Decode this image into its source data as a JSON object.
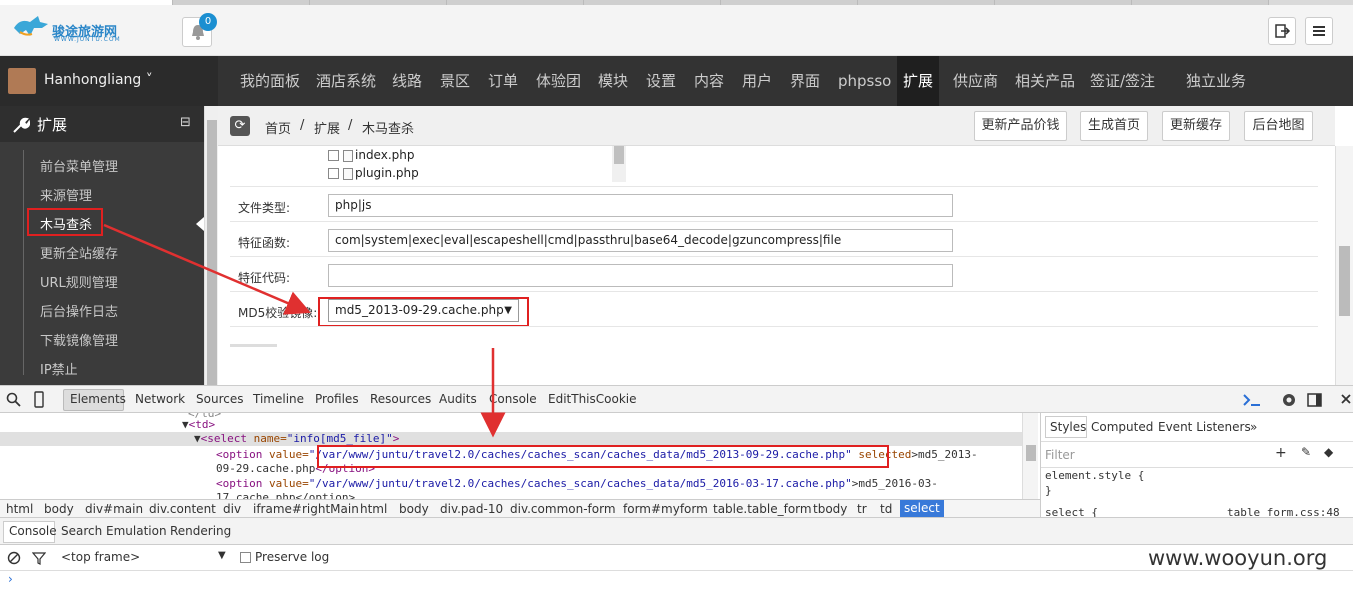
{
  "header": {
    "logo_text": "骏途旅游网",
    "logo_sub": "WWW.JUNTU.COM",
    "notification_count": "0"
  },
  "user": {
    "name": "Hanhongliang"
  },
  "nav": {
    "items": [
      "我的面板",
      "酒店系统",
      "线路",
      "景区",
      "订单",
      "体验团",
      "模块",
      "设置",
      "内容",
      "用户",
      "界面",
      "phpsso",
      "扩展",
      "供应商",
      "相关产品",
      "签证/签注",
      "独立业务"
    ],
    "active": "扩展"
  },
  "sidebar": {
    "title": "扩展",
    "collapse": "⊟",
    "items": [
      "前台菜单管理",
      "来源管理",
      "木马查杀",
      "更新全站缓存",
      "URL规则管理",
      "后台操作日志",
      "下载镜像管理",
      "IP禁止"
    ],
    "active": "木马查杀"
  },
  "breadcrumb": {
    "home": "首页",
    "sep1": "/",
    "section": "扩展",
    "sep2": "/",
    "current": "木马查杀"
  },
  "header_buttons": [
    "更新产品价钱",
    "生成首页",
    "更新缓存",
    "后台地图"
  ],
  "form": {
    "files": [
      "index.php",
      "plugin.php"
    ],
    "file_type_label": "文件类型:",
    "file_type_value": "php|js",
    "func_label": "特征函数:",
    "func_value": "com|system|exec|eval|escapeshell|cmd|passthru|base64_decode|gzuncompress|file",
    "code_label": "特征代码:",
    "code_value": "",
    "md5_label": "MD5校验镜像:",
    "md5_value": "md5_2013-09-29.cache.php"
  },
  "devtools": {
    "tabs": [
      "Elements",
      "Network",
      "Sources",
      "Timeline",
      "Profiles",
      "Resources",
      "Audits",
      "Console",
      "EditThisCookie"
    ],
    "code": {
      "line0": "<td>",
      "line1_tag": "<select",
      "line1_attr": " name=",
      "line1_val": "\"info[md5_file]\"",
      "line1_end": ">",
      "opt1_open": "<option",
      "opt1_attr": " value=",
      "opt1_val": "\"/var/www/juntu/travel2.0/caches/caches_scan/caches_data/md5_2013-09-29.cache.php\"",
      "opt1_sel": " selected",
      "opt1_text": ">md5_2013-",
      "opt1_text2": "09-29.cache.php",
      "opt1_close": "</option>",
      "opt2_open": "<option",
      "opt2_attr": " value=",
      "opt2_val": "\"/var/www/juntu/travel2.0/caches/caches_scan/caches_data/md5_2016-03-17.cache.php\"",
      "opt2_text": ">md5_2016-03-",
      "opt2_text2": "17.cache.php</option>"
    },
    "breadcrumbs": [
      "html",
      "body",
      "div#main",
      "div.content",
      "div",
      "iframe#rightMain",
      "html",
      "body",
      "div.pad-10",
      "div.common-form",
      "form#myform",
      "table.table_form",
      "tbody",
      "tr",
      "td",
      "select"
    ],
    "styles_tabs": [
      "Styles",
      "Computed",
      "Event Listeners",
      "»"
    ],
    "filter_placeholder": "Filter",
    "style_rule1": "element.style {",
    "style_rule1_close": "}",
    "style_rule2": "select {",
    "style_rule2_src": "table_form.css:48",
    "console_tabs": [
      "Console",
      "Search",
      "Emulation",
      "Rendering"
    ],
    "frame": "<top frame>",
    "preserve_log": "Preserve log",
    "prompt": "›"
  },
  "watermark": "www.wooyun.org"
}
